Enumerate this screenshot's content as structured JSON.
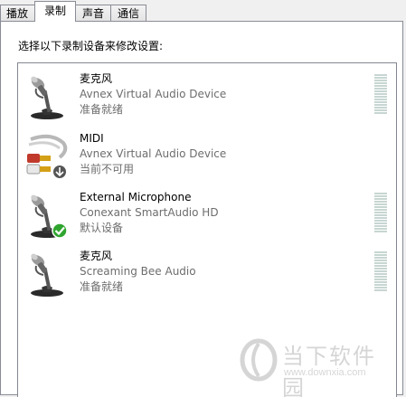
{
  "tabs": [
    {
      "label": "播放",
      "active": false
    },
    {
      "label": "录制",
      "active": true
    },
    {
      "label": "声音",
      "active": false
    },
    {
      "label": "通信",
      "active": false
    }
  ],
  "instruction": "选择以下录制设备来修改设置:",
  "devices": [
    {
      "name": "麦克风",
      "driver": "Avnex Virtual Audio Device",
      "status": "准备就绪",
      "icon": "microphone-icon"
    },
    {
      "name": "MIDI",
      "driver": "Avnex Virtual Audio Device",
      "status": "当前不可用",
      "icon": "audio-cable-icon",
      "badge": "down-arrow-badge-icon"
    },
    {
      "name": "External Microphone",
      "driver": "Conexant SmartAudio HD",
      "status": "默认设备",
      "icon": "microphone-icon",
      "badge": "green-check-badge-icon"
    },
    {
      "name": "麦克风",
      "driver": "Screaming Bee Audio",
      "status": "准备就绪",
      "icon": "microphone-icon"
    }
  ],
  "watermark": {
    "title": "当下软件园",
    "url": "www.downxia.com"
  },
  "colors": {
    "meter": "#c7d6d2",
    "check": "#2fa52f",
    "border": "#828790"
  }
}
